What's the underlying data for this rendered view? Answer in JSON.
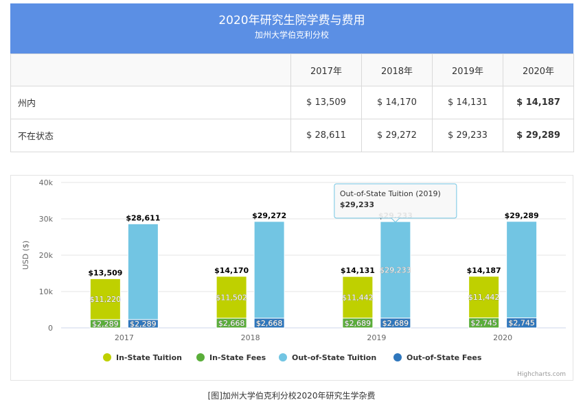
{
  "table": {
    "title": "2020年研究生院学费与费用",
    "subtitle": "加州大学伯克利分校",
    "headers": [
      "",
      "2017年",
      "2018年",
      "2019年",
      "2020年"
    ],
    "rows": [
      {
        "label": "州内",
        "values": [
          "$ 13,509",
          "$ 14,170",
          "$ 14,131",
          "$ 14,187"
        ]
      },
      {
        "label": "不在状态",
        "values": [
          "$ 28,611",
          "$ 29,272",
          "$ 29,233",
          "$ 29,289"
        ]
      }
    ]
  },
  "chart_data": {
    "type": "bar",
    "stacked": true,
    "categories": [
      "2017",
      "2018",
      "2019",
      "2020"
    ],
    "ylabel": "USD ($)",
    "ylim": [
      0,
      40000
    ],
    "yticks": [
      0,
      10000,
      20000,
      30000,
      40000
    ],
    "ytick_labels": [
      "0",
      "10k",
      "20k",
      "30k",
      "40k"
    ],
    "grid": true,
    "legend_position": "bottom",
    "stacks": [
      {
        "name": "In-State",
        "totals": [
          13509,
          14170,
          14131,
          14187
        ],
        "total_labels": [
          "$13,509",
          "$14,170",
          "$14,131",
          "$14,187"
        ]
      },
      {
        "name": "Out-of-State",
        "totals": [
          28611,
          29272,
          29233,
          29289
        ],
        "total_labels": [
          "$28,611",
          "$29,272",
          "$29,233",
          "$29,289"
        ]
      }
    ],
    "series": [
      {
        "name": "In-State Tuition",
        "stack": "In-State",
        "color": "#bfd000",
        "values": [
          11220,
          11502,
          11442,
          11442
        ],
        "labels": [
          "$11,220",
          "$11,502",
          "$11,442",
          "$11,442"
        ]
      },
      {
        "name": "In-State Fees",
        "stack": "In-State",
        "color": "#5aae3a",
        "values": [
          2289,
          2668,
          2689,
          2745
        ],
        "labels": [
          "$2,289",
          "$2,668",
          "$2,689",
          "$2,745"
        ]
      },
      {
        "name": "Out-of-State Tuition",
        "stack": "Out-of-State",
        "color": "#72c5e3",
        "values": [
          26322,
          26604,
          26544,
          26544
        ],
        "labels": [
          "",
          "",
          "$29,233",
          ""
        ]
      },
      {
        "name": "Out-of-State Fees",
        "stack": "Out-of-State",
        "color": "#2f77bd",
        "values": [
          2289,
          2668,
          2689,
          2745
        ],
        "labels": [
          "$2,289",
          "$2,668",
          "$2,689",
          "$2,745"
        ]
      }
    ],
    "tooltip": {
      "title": "Out-of-State Tuition (2019)",
      "value": "$29,233",
      "category": "2019",
      "stack": "Out-of-State"
    },
    "credits": "Highcharts.com"
  },
  "caption": "[图]加州大学伯克利分校2020年研究生学杂费"
}
